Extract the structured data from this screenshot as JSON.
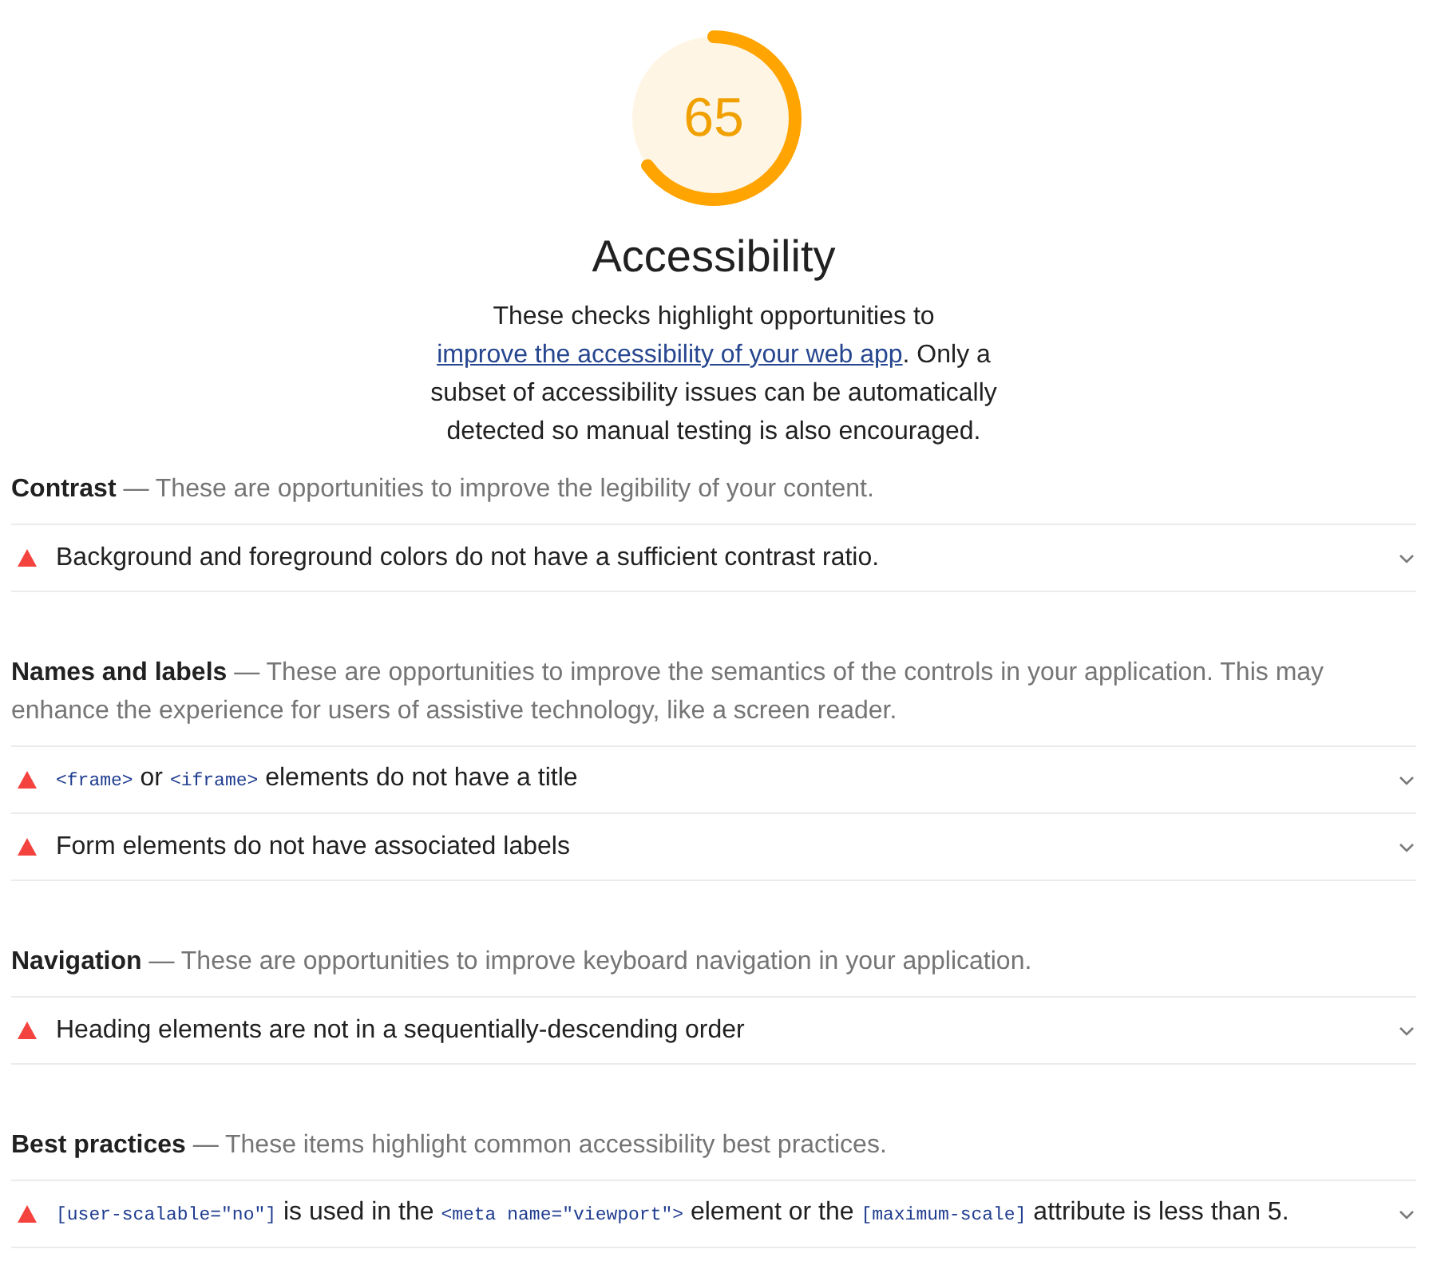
{
  "category": {
    "score": "65",
    "level": 0.65,
    "title": "Accessibility",
    "description": [
      {
        "kind": "text",
        "text": "These checks highlight opportunities to "
      },
      {
        "kind": "link",
        "text": "improve the accessibility of your web app"
      },
      {
        "kind": "text",
        "text": ". Only a subset of accessibility issues can be automatically detected so manual testing is also encouraged."
      }
    ]
  },
  "groups": [
    {
      "title": "Contrast",
      "description": "— These are opportunities to improve the legibility of your content.",
      "audits": [
        {
          "kind": "fail",
          "expanded": false,
          "title": [
            {
              "kind": "text",
              "text": "Background and foreground colors do not have a sufficient contrast ratio."
            }
          ]
        }
      ]
    },
    {
      "title": "Names and labels",
      "description": "— These are opportunities to improve the semantics of the controls in your application. This may enhance the experience for users of assistive technology, like a screen reader.",
      "audits": [
        {
          "kind": "fail",
          "expanded": false,
          "title": [
            {
              "kind": "code",
              "text": "<frame>"
            },
            {
              "kind": "text",
              "text": " or "
            },
            {
              "kind": "code",
              "text": "<iframe>"
            },
            {
              "kind": "text",
              "text": " elements do not have a title"
            }
          ]
        },
        {
          "kind": "fail",
          "expanded": false,
          "title": [
            {
              "kind": "text",
              "text": "Form elements do not have associated labels"
            }
          ]
        }
      ]
    },
    {
      "title": "Navigation",
      "description": "— These are opportunities to improve keyboard navigation in your application.",
      "audits": [
        {
          "kind": "fail",
          "expanded": false,
          "title": [
            {
              "kind": "text",
              "text": "Heading elements are not in a sequentially-descending order"
            }
          ]
        }
      ]
    },
    {
      "title": "Best practices",
      "description": "— These items highlight common accessibility best practices.",
      "audits": [
        {
          "kind": "fail",
          "expanded": false,
          "title": [
            {
              "kind": "code",
              "text": "[user-scalable=\"no\"]"
            },
            {
              "kind": "text",
              "text": " is used in the "
            },
            {
              "kind": "code",
              "text": "<meta name=\"viewport\">"
            },
            {
              "kind": "text",
              "text": " element or the "
            },
            {
              "kind": "code",
              "text": "[maximum-scale]"
            },
            {
              "kind": "text",
              "text": " attribute is less than 5."
            }
          ]
        }
      ]
    }
  ]
}
